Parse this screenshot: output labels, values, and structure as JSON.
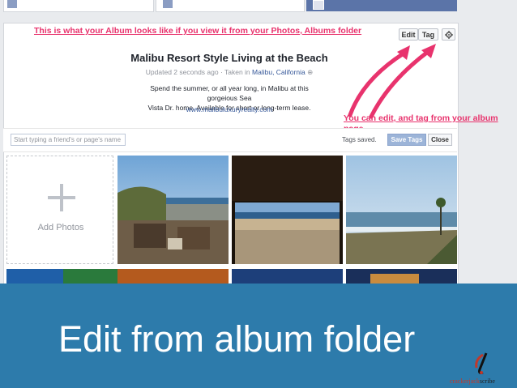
{
  "annotations": {
    "top": "This is what your Album looks like if you view it from your Photos, Albums folder",
    "side_line1": "You can edit, and tag from your album",
    "side_line2": "page."
  },
  "toolbar": {
    "edit_label": "Edit",
    "tag_label": "Tag",
    "settings_icon": "gear-icon"
  },
  "album": {
    "title": "Malibu Resort Style Living at the Beach",
    "meta_prefix": "Updated 2 seconds ago · Taken in",
    "location": "Malibu, California",
    "description_line1": "Spend the summer, or all year long, in Malibu at this gorgeious Sea",
    "description_line2": "Vista Dr. home. Available for short or long-term lease.",
    "link": "www.malibuluxuryrealty.com"
  },
  "tagging": {
    "placeholder": "Start typing a friend's or page's name",
    "status": "Tags saved.",
    "save_label": "Save Tags",
    "close_label": "Close"
  },
  "grid": {
    "add_photos_label": "Add Photos"
  },
  "slide": {
    "caption": "Edit from album folder",
    "brand_part1": "crackerjack",
    "brand_part2": "scribe"
  },
  "colors": {
    "annotation": "#e8336d",
    "footer": "#2d7bab",
    "accent": "#365899"
  }
}
